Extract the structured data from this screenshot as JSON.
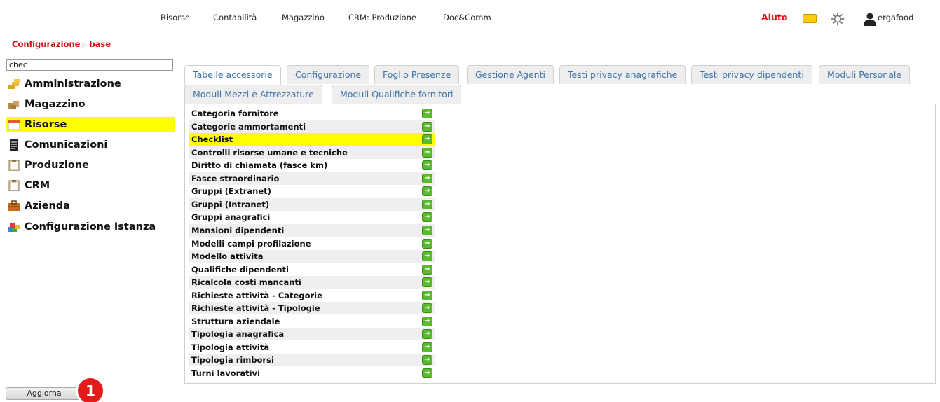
{
  "topnav": {
    "menu": [
      "Risorse",
      "Contabilità",
      "Magazzino",
      "CRM: Produzione",
      "Doc&Comm"
    ],
    "help_label": "Aiuto",
    "user_name": "ergafood",
    "help_color": "#e01010"
  },
  "breadcrumb": {
    "root": "Configurazione",
    "current": "base"
  },
  "sidebar": {
    "search_value": "chec",
    "items": [
      {
        "label": "Amministrazione",
        "icon": "coins-icon"
      },
      {
        "label": "Magazzino",
        "icon": "boxes-icon"
      },
      {
        "label": "Risorse",
        "icon": "calendar-icon",
        "active": true
      },
      {
        "label": "Comunicazioni",
        "icon": "document-icon"
      },
      {
        "label": "Produzione",
        "icon": "clipboard-icon"
      },
      {
        "label": "CRM",
        "icon": "clipboard-icon"
      },
      {
        "label": "Azienda",
        "icon": "briefcase-icon"
      },
      {
        "label": "Configurazione Istanza",
        "icon": "blocks-icon"
      }
    ],
    "update_label": "Aggiorna",
    "badge_count": "1"
  },
  "tabs": [
    {
      "label": "Tabelle accessorie",
      "active": true
    },
    {
      "label": "Configurazione"
    },
    {
      "label": "Foglio Presenze"
    },
    {
      "label": "Gestione Agenti"
    },
    {
      "label": "Testi privacy anagrafiche"
    },
    {
      "label": "Testi privacy dipendenti"
    },
    {
      "label": "Moduli Personale"
    },
    {
      "label": "Moduli Mezzi e Attrezzature"
    },
    {
      "label": "Moduli Qualifiche fornitori"
    }
  ],
  "rows": [
    "Categoria fornitore",
    "Categorie ammortamenti",
    "Checklist",
    "Controlli risorse umane e tecniche",
    "Diritto di chiamata (fasce km)",
    "Fasce straordinario",
    "Gruppi (Extranet)",
    "Gruppi (Intranet)",
    "Gruppi anagrafici",
    "Mansioni dipendenti",
    "Modelli campi profilazione",
    "Modello attivita",
    "Qualifiche dipendenti",
    "Ricalcola costi mancanti",
    "Richieste attività - Categorie",
    "Richieste attività - Tipologie",
    "Struttura aziendale",
    "Tipologia anagrafica",
    "Tipologia attività",
    "Tipologia rimborsi",
    "Turni lavorativi"
  ],
  "active_row": "Checklist",
  "colors": {
    "highlight": "#ffff00",
    "go_button": "#5cba2f",
    "tab_text": "#3c72a8",
    "breadcrumb": "#cc1111"
  }
}
